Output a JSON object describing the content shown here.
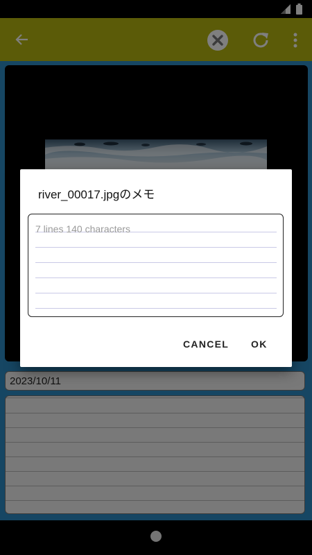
{
  "toolbar": {
    "back_icon": "arrow-left-icon",
    "clear_icon": "close-circle-icon",
    "refresh_icon": "refresh-icon",
    "more_icon": "more-vert-icon",
    "color": "#b6b610"
  },
  "main": {
    "date": "2023/10/11",
    "background_color": "#2c8cc7"
  },
  "dialog": {
    "title": "river_00017.jpgのメモ",
    "memo_placeholder": "7 lines 140 characters",
    "cancel_label": "CANCEL",
    "ok_label": "OK"
  }
}
